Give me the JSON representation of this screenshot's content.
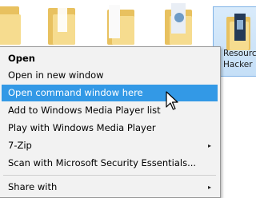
{
  "desktop": {
    "selected_item_label_line1": "Resource",
    "selected_item_label_line2": "Hacker",
    "folder_icon": "folder-icon"
  },
  "context_menu": {
    "items": [
      {
        "label": "Open",
        "bold": true
      },
      {
        "label": "Open in new window"
      },
      {
        "label": "Open command window here",
        "highlighted": true
      },
      {
        "label": "Add to Windows Media Player list"
      },
      {
        "label": "Play with Windows Media Player"
      },
      {
        "label": "7-Zip",
        "submenu": true
      },
      {
        "label": "Scan with Microsoft Security Essentials..."
      },
      {
        "label": "Share with",
        "submenu": true
      }
    ],
    "submenu_arrow": "▸"
  },
  "colors": {
    "highlight": "#3399e6",
    "menu_background": "#f2f2f2",
    "folder_yellow": "#f3d27a"
  }
}
